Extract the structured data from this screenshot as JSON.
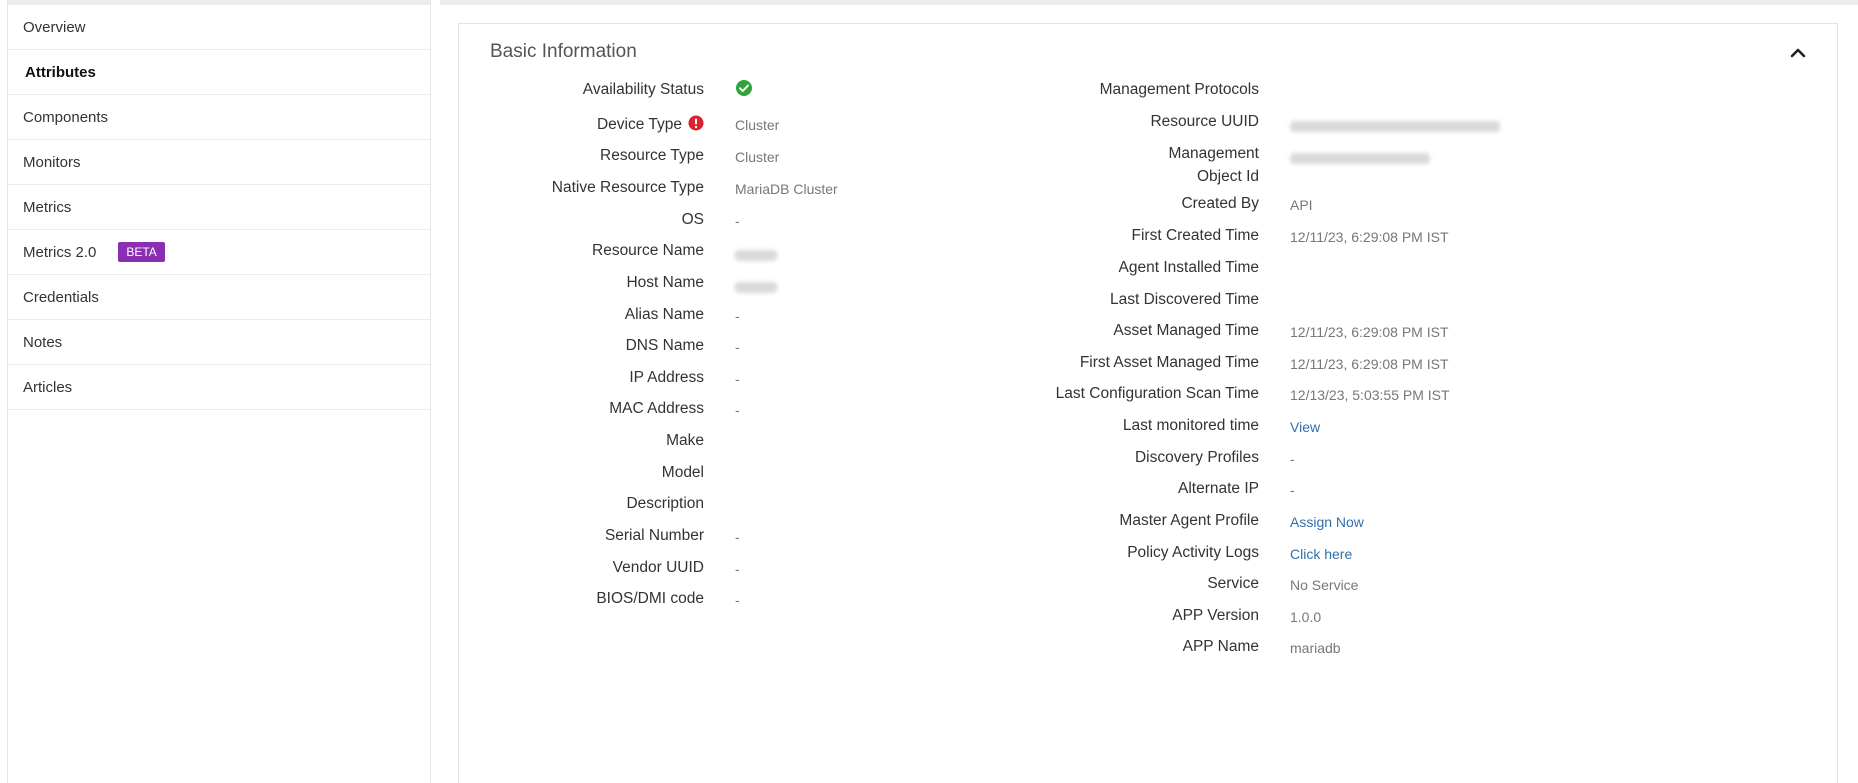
{
  "sidebar": {
    "items": [
      {
        "label": "Overview"
      },
      {
        "label": "Attributes"
      },
      {
        "label": "Components"
      },
      {
        "label": "Monitors"
      },
      {
        "label": "Metrics"
      },
      {
        "label": "Metrics 2.0",
        "badge": "BETA"
      },
      {
        "label": "Credentials"
      },
      {
        "label": "Notes"
      },
      {
        "label": "Articles"
      }
    ],
    "active": "Attributes",
    "badge_color": "#8b2eb3"
  },
  "card": {
    "title": "Basic Information",
    "collapse_icon": "chevron-up-icon"
  },
  "left_fields": [
    {
      "label": "Availability Status",
      "value": "",
      "icon": "check-circle-icon"
    },
    {
      "label": "Device Type",
      "value": "Cluster",
      "label_icon": "alert-icon"
    },
    {
      "label": "Resource Type",
      "value": "Cluster"
    },
    {
      "label": "Native Resource Type",
      "value": "MariaDB Cluster"
    },
    {
      "label": "OS",
      "value": "-"
    },
    {
      "label": "Resource Name",
      "value": "",
      "redacted": true
    },
    {
      "label": "Host Name",
      "value": "",
      "redacted": true
    },
    {
      "label": "Alias Name",
      "value": "-"
    },
    {
      "label": "DNS Name",
      "value": "-"
    },
    {
      "label": "IP Address",
      "value": "-"
    },
    {
      "label": "MAC Address",
      "value": "-"
    },
    {
      "label": "Make",
      "value": ""
    },
    {
      "label": "Model",
      "value": ""
    },
    {
      "label": "Description",
      "value": ""
    },
    {
      "label": "Serial Number",
      "value": "-"
    },
    {
      "label": "Vendor UUID",
      "value": "-"
    },
    {
      "label": "BIOS/DMI code",
      "value": "-"
    }
  ],
  "right_fields": [
    {
      "label": "Management Protocols",
      "value": ""
    },
    {
      "label": "Resource UUID",
      "value": "",
      "redacted": true
    },
    {
      "label_lines": [
        "Management",
        "Object Id"
      ],
      "value": "",
      "redacted": true
    },
    {
      "label": "Created By",
      "value": "API"
    },
    {
      "label": "First Created Time",
      "value": "12/11/23, 6:29:08 PM IST"
    },
    {
      "label": "Agent Installed Time",
      "value": ""
    },
    {
      "label": "Last Discovered Time",
      "value": ""
    },
    {
      "label": "Asset Managed Time",
      "value": "12/11/23, 6:29:08 PM IST"
    },
    {
      "label": "First Asset Managed Time",
      "value": "12/11/23, 6:29:08 PM IST"
    },
    {
      "label": "Last Configuration Scan Time",
      "value": "12/13/23, 5:03:55 PM IST"
    },
    {
      "label": "Last monitored time",
      "value": "View",
      "link": true
    },
    {
      "label": "Discovery Profiles",
      "value": "-"
    },
    {
      "label": "Alternate IP",
      "value": "-"
    },
    {
      "label": "Master Agent Profile",
      "value": "Assign Now",
      "link": true
    },
    {
      "label": "Policy Activity Logs",
      "value": "Click here",
      "link": true
    },
    {
      "label": "Service",
      "value": "No Service"
    },
    {
      "label": "APP Version",
      "value": "1.0.0"
    },
    {
      "label": "APP Name",
      "value": "mariadb"
    }
  ],
  "colors": {
    "status_ok": "#2ea43a",
    "alert": "#d9232e",
    "link": "#2f6fad"
  }
}
